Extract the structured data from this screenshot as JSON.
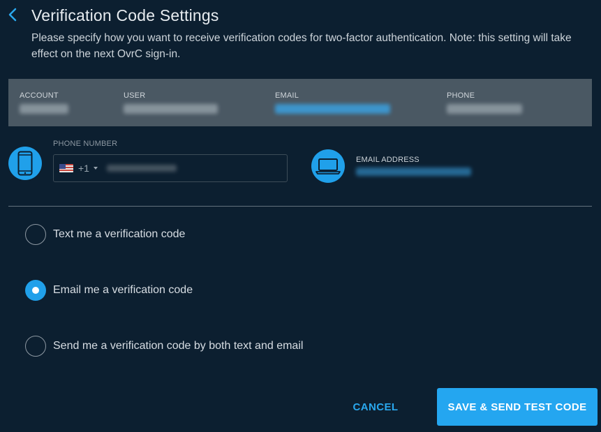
{
  "header": {
    "title": "Verification Code Settings",
    "description": "Please specify how you want to receive verification codes for two-factor authentication. Note: this setting will take effect on the next OvrC sign-in.",
    "back_icon": "chevron-left-icon"
  },
  "account_info": {
    "columns": [
      {
        "label": "ACCOUNT",
        "value": ""
      },
      {
        "label": "USER",
        "value": ""
      },
      {
        "label": "EMAIL",
        "value": ""
      },
      {
        "label": "PHONE",
        "value": ""
      }
    ]
  },
  "contact": {
    "phone": {
      "label": "PHONE NUMBER",
      "country_code": "+1",
      "icon": "smartphone-icon",
      "value": "",
      "placeholder": ""
    },
    "email": {
      "label": "EMAIL ADDRESS",
      "icon": "laptop-icon",
      "value": ""
    }
  },
  "options": [
    {
      "label": "Text me a verification code",
      "selected": false
    },
    {
      "label": "Email me a verification code",
      "selected": true
    },
    {
      "label": "Send me a verification code by both text and email",
      "selected": false
    }
  ],
  "footer": {
    "cancel_label": "CANCEL",
    "submit_label": "SAVE & SEND TEST CODE"
  },
  "colors": {
    "background": "#0c1f30",
    "accent": "#20a0ea",
    "info_band": "#4a5863"
  }
}
